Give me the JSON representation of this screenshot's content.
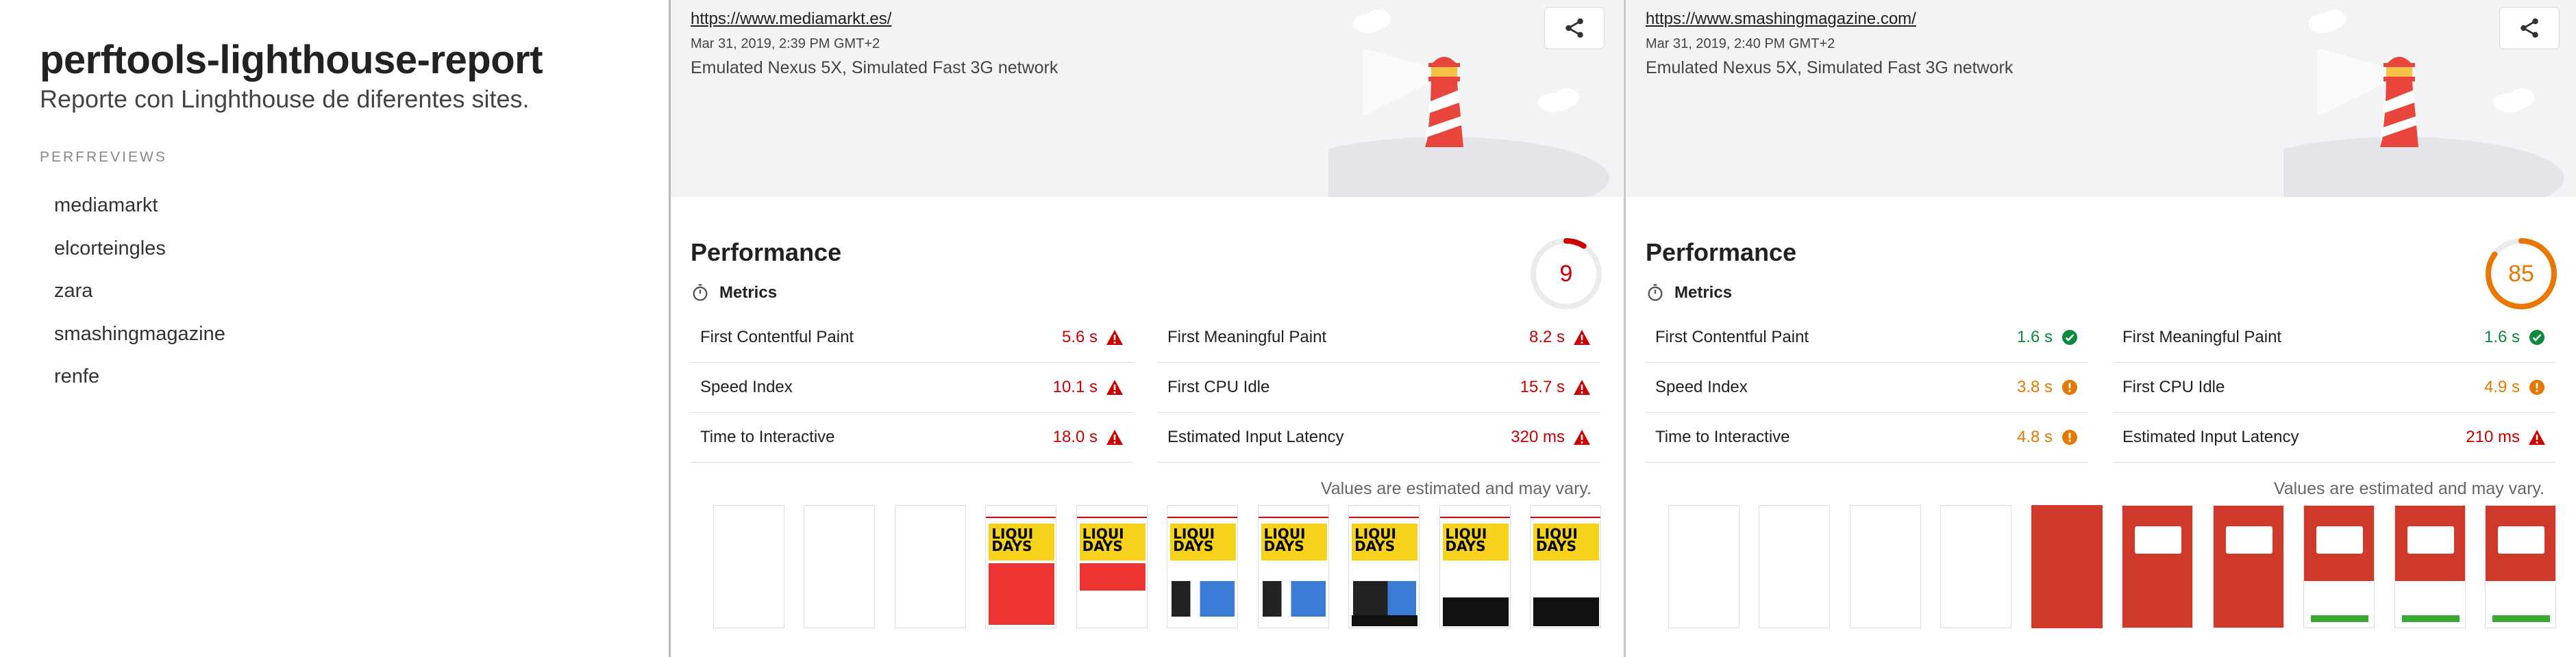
{
  "sidebar": {
    "title": "perftools-lighthouse-report",
    "subtitle": "Reporte con Linghthouse de diferentes sites.",
    "section_heading": "PERFREVIEWS",
    "items": [
      {
        "label": "mediamarkt"
      },
      {
        "label": "elcorteingles"
      },
      {
        "label": "zara"
      },
      {
        "label": "smashingmagazine"
      },
      {
        "label": "renfe"
      }
    ]
  },
  "reports": [
    {
      "url": "https://www.mediamarkt.es/",
      "date": "Mar 31, 2019, 2:39 PM GMT+2",
      "environment": "Emulated Nexus 5X, Simulated Fast 3G network",
      "category_title": "Performance",
      "score": "9",
      "score_fraction": 0.09,
      "score_color": "#cc0000",
      "metrics_label": "Metrics",
      "metrics": [
        {
          "name": "First Contentful Paint",
          "value": "5.6 s",
          "status": "fail"
        },
        {
          "name": "First Meaningful Paint",
          "value": "8.2 s",
          "status": "fail"
        },
        {
          "name": "Speed Index",
          "value": "10.1 s",
          "status": "fail"
        },
        {
          "name": "First CPU Idle",
          "value": "15.7 s",
          "status": "fail"
        },
        {
          "name": "Time to Interactive",
          "value": "18.0 s",
          "status": "fail"
        },
        {
          "name": "Estimated Input Latency",
          "value": "320 ms",
          "status": "fail"
        }
      ],
      "note": "Values are estimated and may vary.",
      "banner_text": "LIQUI DAYS"
    },
    {
      "url": "https://www.smashingmagazine.com/",
      "date": "Mar 31, 2019, 2:40 PM GMT+2",
      "environment": "Emulated Nexus 5X, Simulated Fast 3G network",
      "category_title": "Performance",
      "score": "85",
      "score_fraction": 0.85,
      "score_color": "#e67700",
      "metrics_label": "Metrics",
      "metrics": [
        {
          "name": "First Contentful Paint",
          "value": "1.6 s",
          "status": "pass"
        },
        {
          "name": "First Meaningful Paint",
          "value": "1.6 s",
          "status": "pass"
        },
        {
          "name": "Speed Index",
          "value": "3.8 s",
          "status": "average"
        },
        {
          "name": "First CPU Idle",
          "value": "4.9 s",
          "status": "average"
        },
        {
          "name": "Time to Interactive",
          "value": "4.8 s",
          "status": "average"
        },
        {
          "name": "Estimated Input Latency",
          "value": "210 ms",
          "status": "fail"
        }
      ],
      "note": "Values are estimated and may vary."
    }
  ],
  "colors": {
    "pass": "#0a8a3a",
    "average": "#e67700",
    "fail": "#cc0000"
  },
  "icons": {
    "share": "share-icon",
    "metrics": "stopwatch-icon",
    "pass": "check-circle-icon",
    "average": "info-circle-icon",
    "fail": "warning-triangle-icon"
  }
}
